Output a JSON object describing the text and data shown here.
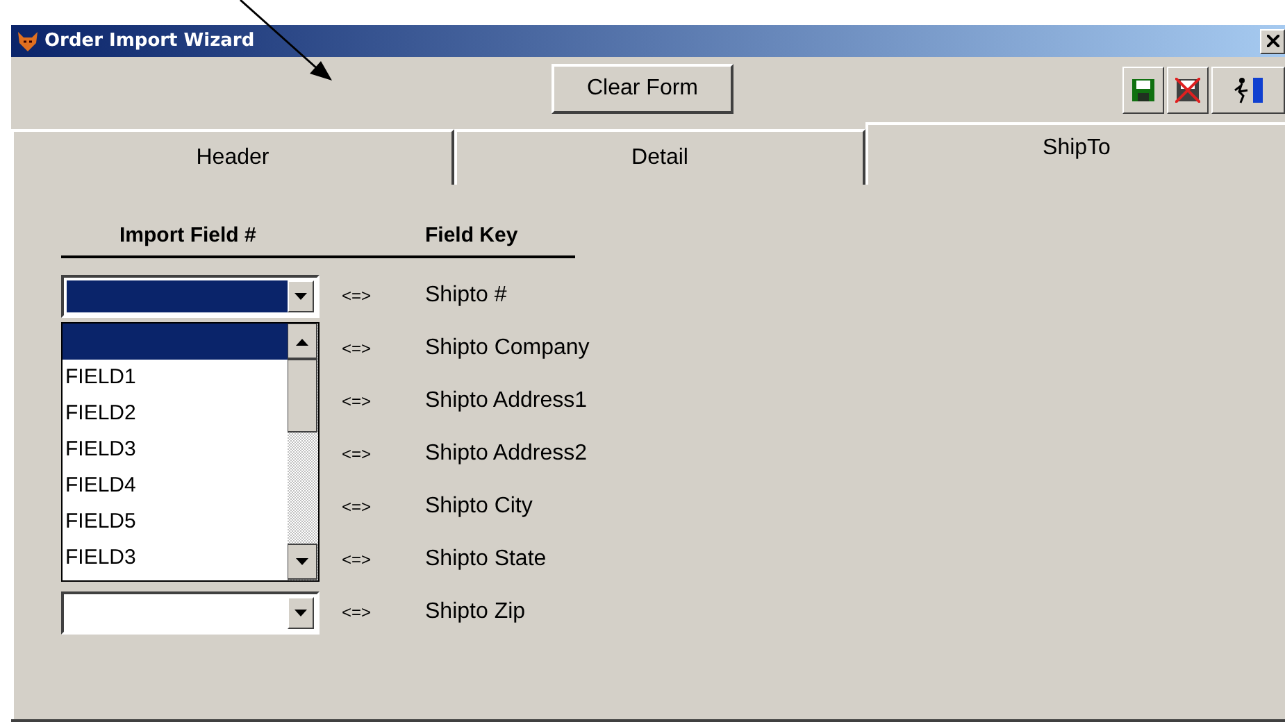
{
  "window": {
    "title": "Order Import Wizard"
  },
  "toolbar": {
    "clear_button": "Clear Form"
  },
  "tabs": [
    {
      "label": "Header",
      "selected": false
    },
    {
      "label": "Detail",
      "selected": false
    },
    {
      "label": "ShipTo",
      "selected": true
    }
  ],
  "columns": [
    "Import Field #",
    "Field Key"
  ],
  "rows": [
    {
      "combo": {
        "focused": true
      },
      "separator": "<=>",
      "field_key": "Shipto #"
    },
    {
      "separator": "<=>",
      "field_key": "Shipto Company"
    },
    {
      "separator": "<=>",
      "field_key": "Shipto Address1"
    },
    {
      "separator": "<=>",
      "field_key": "Shipto Address2"
    },
    {
      "separator": "<=>",
      "field_key": "Shipto City"
    },
    {
      "separator": "<=>",
      "field_key": "Shipto State"
    },
    {
      "combo": {
        "focused": false
      },
      "separator": "<=>",
      "field_key": "Shipto Zip"
    }
  ],
  "dropdown_list": [
    {
      "selected": true
    },
    {
      "label": "FIELD1",
      "selected": false
    },
    {
      "label": "FIELD2",
      "selected": false
    },
    {
      "label": "FIELD3",
      "selected": false
    },
    {
      "label": "FIELD4",
      "selected": false
    },
    {
      "label": "FIELD5",
      "selected": false
    },
    {
      "label": "FIELD3",
      "selected": false
    }
  ]
}
